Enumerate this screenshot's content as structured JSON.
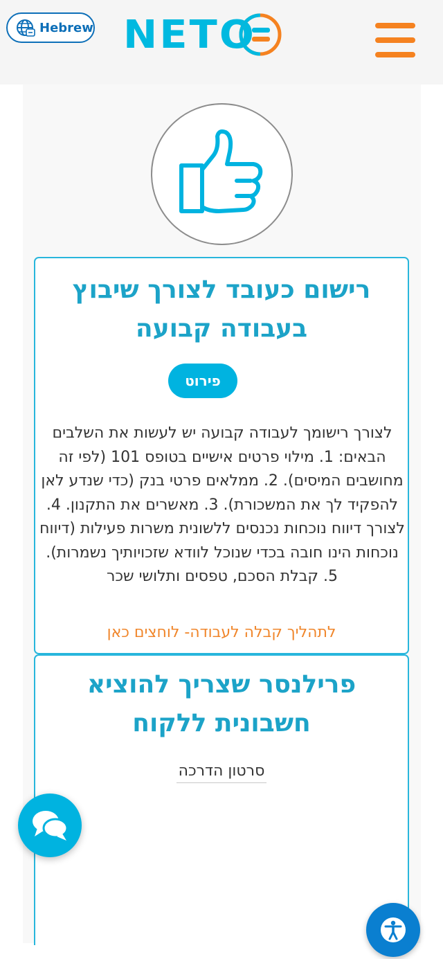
{
  "header": {
    "language_label": "Hebrew",
    "logo_text": "NETO",
    "colors": {
      "brand_cyan": "#00b9e0",
      "brand_orange": "#f58220",
      "brand_blue": "#0d6fb8"
    }
  },
  "hero": {
    "icon": "thumbs-up-icon"
  },
  "cards": [
    {
      "title": "רישום כעובד לצורך שיבוץ בעבודה קבועה",
      "details_button": "פירוט",
      "body": "לצורך רישומך לעבודה קבועה יש לעשות את השלבים הבאים: 1. מילוי פרטים אישיים בטופס 101 (לפי זה מחושבים המיסים). 2. ממלאים פרטי בנק (כדי שנדע לאן להפקיד לך את המשכורת). 3. מאשרים את התקנון. 4. לצורך דיווח נוכחות נכנסים ללשונית משרות פעילות (דיווח נוכחות הינו חובה בכדי שנוכל לוודא שזכויותיך נשמרות). 5. קבלת הסכם, טפסים ותלושי שכר",
      "link": "לתהליך קבלה לעבודה- לוחצים כאן"
    },
    {
      "title": "פרילנסר שצריך להוציא חשבונית ללקוח",
      "link": "סרטון הדרכה"
    }
  ],
  "floating": {
    "chat_icon": "chat-bubbles-icon",
    "accessibility_icon": "accessibility-icon"
  }
}
